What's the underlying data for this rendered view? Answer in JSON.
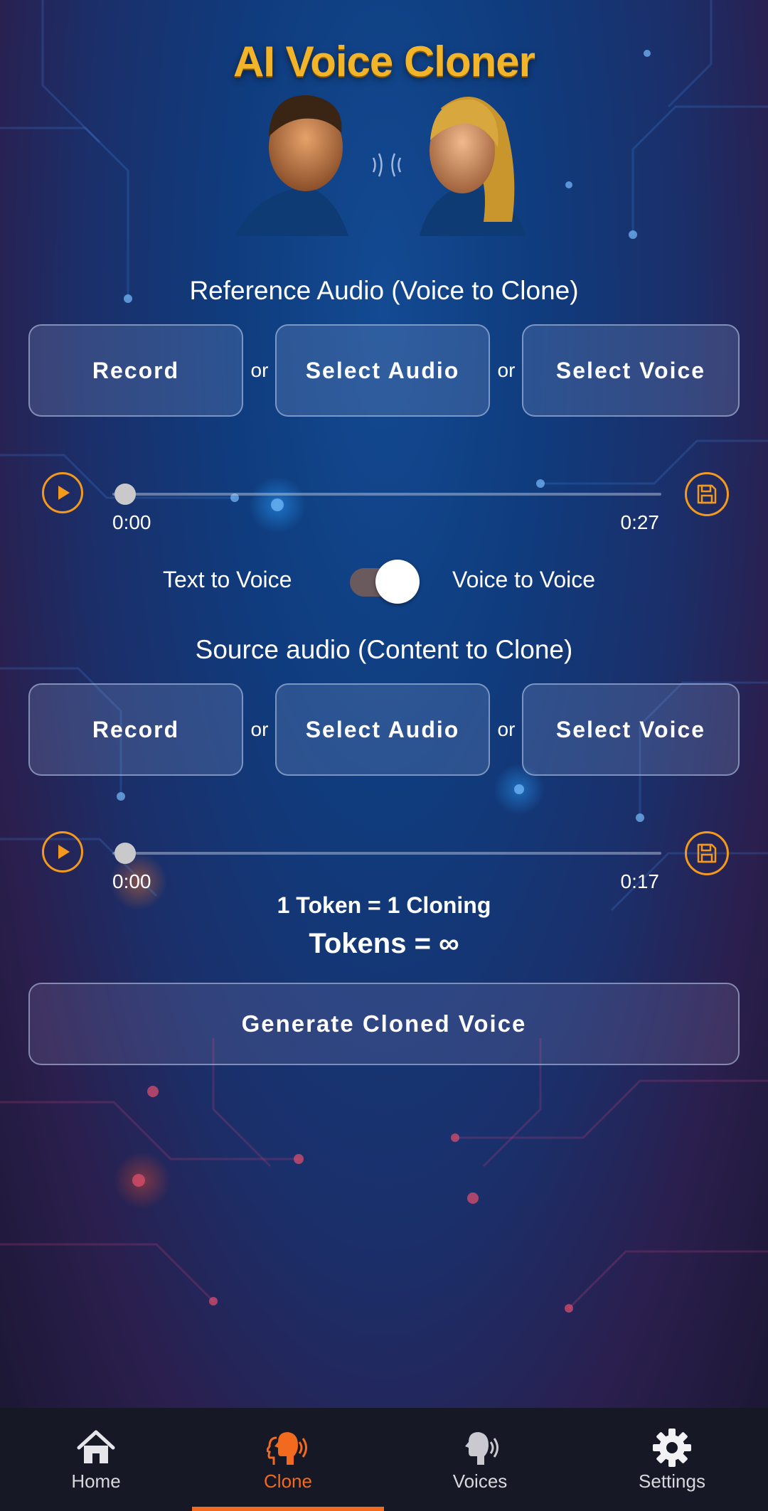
{
  "app": {
    "title": "AI Voice Cloner"
  },
  "reference": {
    "title": "Reference Audio (Voice to Clone)",
    "record_label": "Record",
    "select_audio_label": "Select Audio",
    "select_voice_label": "Select Voice",
    "or_label": "or",
    "player": {
      "start_time": "0:00",
      "end_time": "0:27",
      "progress": 0
    }
  },
  "mode_toggle": {
    "left_label": "Text to Voice",
    "right_label": "Voice to Voice",
    "selected": "Voice to Voice"
  },
  "source": {
    "title": "Source audio (Content to Clone)",
    "record_label": "Record",
    "select_audio_label": "Select Audio",
    "select_voice_label": "Select Voice",
    "or_label": "or",
    "player": {
      "start_time": "0:00",
      "end_time": "0:17",
      "progress": 0
    }
  },
  "tokens": {
    "rate_text": "1 Token = 1 Cloning",
    "count_text": "Tokens = ∞"
  },
  "generate": {
    "label": "Generate Cloned Voice"
  },
  "nav": {
    "items": [
      {
        "label": "Home",
        "icon": "home-icon"
      },
      {
        "label": "Clone",
        "icon": "clone-icon"
      },
      {
        "label": "Voices",
        "icon": "voices-icon"
      },
      {
        "label": "Settings",
        "icon": "gear-icon"
      }
    ],
    "active": "Clone"
  },
  "colors": {
    "accent": "#f39a1e",
    "active_nav": "#f26a1e",
    "title_gold": "#f2b52a"
  }
}
